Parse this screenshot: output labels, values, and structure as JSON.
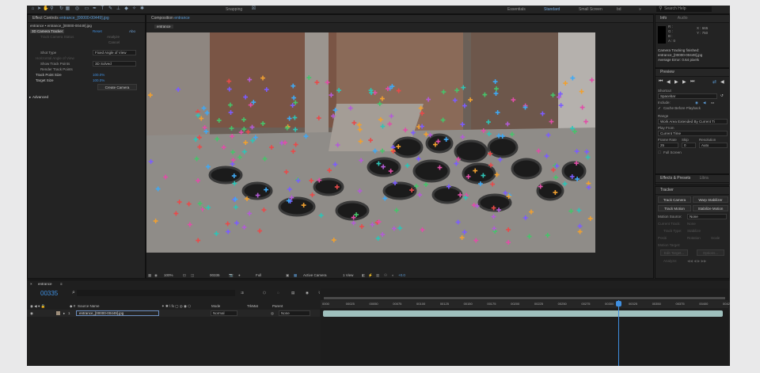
{
  "topbar": {
    "snapping_label": "Snapping",
    "workspaces": [
      "Essentials",
      "Standard",
      "Small Screen",
      "bd"
    ],
    "active_workspace": "Standard",
    "search_placeholder": "Search Help"
  },
  "effect_controls": {
    "tab_label": "Effect Controls",
    "tab_file": "entrance_[00000-00449].jpg",
    "breadcrumb": "entrance • entrance_[00000-00449].jpg",
    "effect_name": "3D Camera Tracker",
    "reset_label": "Reset",
    "about_label": "Abo",
    "analyze_label": "Analyze",
    "cancel_label": "Cancel",
    "status_label": "Track Camera Status",
    "shot_type_label": "Shot Type",
    "shot_type_value": "Fixed Angle of View",
    "angle_label": "Horizontal Angle of View",
    "show_track_points_label": "Show Track Points",
    "show_track_points_value": "3D Solved",
    "render_track_points_label": "Render Track Points",
    "track_point_size_label": "Track Point Size",
    "track_point_size_value": "100.0%",
    "target_size_label": "Target Size",
    "target_size_value": "100.0%",
    "create_camera_label": "Create Camera",
    "advanced_label": "Advanced"
  },
  "composition": {
    "tab_label": "Composition",
    "tab_name": "entrance",
    "subtab": "entrance"
  },
  "viewer_toolbar": {
    "zoom": "100%",
    "timecode": "00335",
    "resolution": "Full",
    "camera": "Active Camera",
    "view": "1 View",
    "exposure": "+0.0"
  },
  "info": {
    "tab_label": "Info",
    "audio_tab": "Audio",
    "r": "R :",
    "g": "G :",
    "b": "B :",
    "a": "A : 0",
    "x": "X : 665",
    "y": "Y : 750",
    "message_line1": "Camera Tracking finished:",
    "message_line2": "entrance_[00000-00449].jpg",
    "message_line3": "Average Error: 0.64 pixels"
  },
  "preview": {
    "tab_label": "Preview",
    "shortcut_label": "Shortcut",
    "shortcut_value": "Spacebar",
    "include_label": "Include:",
    "cache_label": "Cache Before Playback",
    "range_label": "Range",
    "range_value": "Work Area Extended By Current Ti",
    "play_from_label": "Play From",
    "play_from_value": "Current Time",
    "frame_rate_label": "Frame Rate",
    "skip_label": "Skip",
    "resolution_label": "Resolution",
    "frame_rate_value": "25",
    "skip_value": "0",
    "resolution_value": "Auto",
    "full_screen_label": "Full Screen"
  },
  "effects_presets": {
    "tab_label": "Effects & Presets",
    "libraries_tab": "Libra"
  },
  "tracker": {
    "tab_label": "Tracker",
    "track_camera": "Track Camera",
    "warp_stabilizer": "Warp Stabilizer",
    "track_motion": "Track Motion",
    "stabilize_motion": "Stabilize Motion",
    "motion_source_label": "Motion Source:",
    "motion_source_value": "None",
    "current_track_label": "Current Track:",
    "current_track_value": "None",
    "track_type_label": "Track Type:",
    "track_type_value": "Stabilize",
    "position_label": "Positi",
    "rotation_label": "Rotation",
    "scale_label": "Scale",
    "motion_target_label": "Motion Target:",
    "edit_target_label": "Edit Target...",
    "options_label": "Options...",
    "analyze_label": "Analyze:"
  },
  "timeline": {
    "tab_label": "entrance",
    "timecode": "00335",
    "search_icon_label": "⌕",
    "headers": {
      "source_name": "Source Name",
      "mode": "Mode",
      "trkmat": "TrkMat",
      "parent": "Parent"
    },
    "layer": {
      "index": "1",
      "name": "entrance_[00000-00449].jpg",
      "mode": "Normal",
      "parent": "None"
    },
    "ruler": [
      "0000",
      "00025",
      "00050",
      "00075",
      "00100",
      "00125",
      "00150",
      "00175",
      "00200",
      "00225",
      "00250",
      "00275",
      "00300",
      "00325",
      "00350",
      "00375",
      "00400",
      "00425"
    ]
  },
  "colors": {
    "accent": "#3f8fe0",
    "track_bar": "#9fc0bd"
  }
}
